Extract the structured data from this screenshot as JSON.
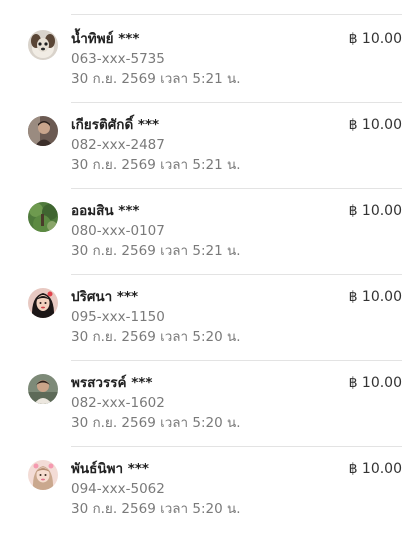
{
  "transactions": [
    {
      "name": "น้ำทิพย์ ***",
      "phone": "063-xxx-5735",
      "datetime": "30 ก.ย. 2569 เวลา 5:21 น.",
      "amount": "฿ 10.00",
      "avatar": "dog-photo"
    },
    {
      "name": "เกียรติศักดิ์ ***",
      "phone": "082-xxx-2487",
      "datetime": "30 ก.ย. 2569 เวลา 5:21 น.",
      "amount": "฿ 10.00",
      "avatar": "person-photo"
    },
    {
      "name": "ออมสิน ***",
      "phone": "080-xxx-0107",
      "datetime": "30 ก.ย. 2569 เวลา 5:21 น.",
      "amount": "฿ 10.00",
      "avatar": "nature-photo"
    },
    {
      "name": "ปริศนา ***",
      "phone": "095-xxx-1150",
      "datetime": "30 ก.ย. 2569 เวลา 5:20 น.",
      "amount": "฿ 10.00",
      "avatar": "woman-photo"
    },
    {
      "name": "พรสวรรค์ ***",
      "phone": "082-xxx-1602",
      "datetime": "30 ก.ย. 2569 เวลา 5:20 น.",
      "amount": "฿ 10.00",
      "avatar": "person-photo"
    },
    {
      "name": "พันธ์นิพา ***",
      "phone": "094-xxx-5062",
      "datetime": "30 ก.ย. 2569 เวลา 5:20 น.",
      "amount": "฿ 10.00",
      "avatar": "woman-photo"
    }
  ],
  "colors": {
    "name": "#222222",
    "secondary_text": "#7a7a7a",
    "amount": "#333333",
    "divider": "#e3e3e3"
  }
}
